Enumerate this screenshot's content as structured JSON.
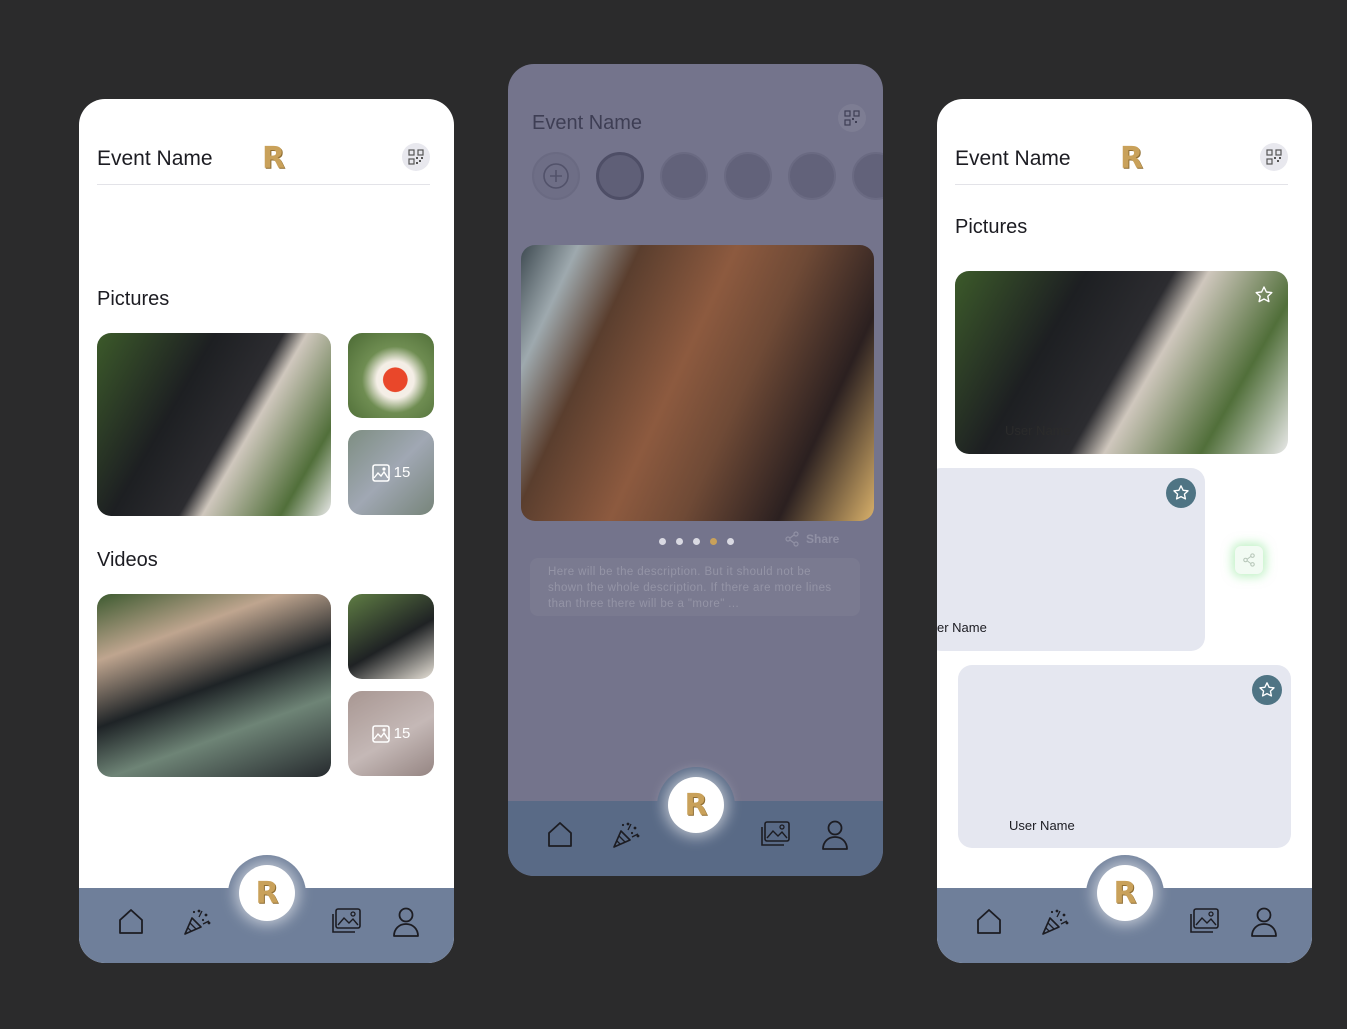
{
  "screens": [
    {
      "title": "Event Name",
      "logo": "R",
      "sections": {
        "pictures": "Pictures",
        "videos": "Videos"
      },
      "picture_count": "15",
      "video_count": "15"
    },
    {
      "title": "Event Name",
      "share": "Share",
      "description": "Here will be the description. But it should not be shown the whole description. If there are more lines than three there will be a \"more\" ...",
      "carousel": {
        "total": 5,
        "active": 4
      }
    },
    {
      "title": "Event Name",
      "sections": {
        "pictures": "Pictures"
      },
      "cards": [
        "User Name",
        "er Name",
        "User Name"
      ]
    }
  ],
  "nav": {
    "center_logo": "R"
  },
  "colors": {
    "accent_gold": "#c9a15a",
    "nav_bg": "#6f7f9a",
    "star_badge": "#4f7484"
  }
}
